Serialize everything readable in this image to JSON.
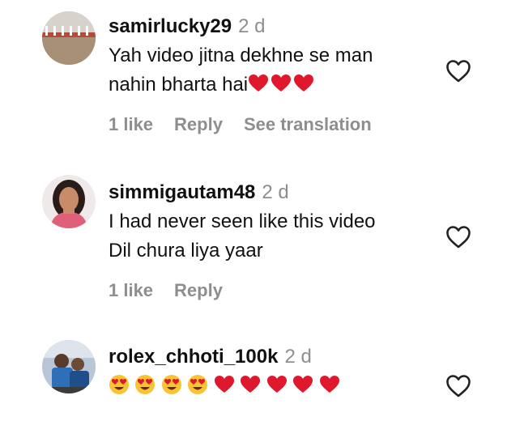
{
  "comments": [
    {
      "username": "samirlucky29",
      "time": "2 d",
      "text_line1": "Yah video jitna dekhne se man",
      "text_line2": "nahin bharta hai",
      "likes": "1 like",
      "reply": "Reply",
      "translation": "See translation"
    },
    {
      "username": "simmigautam48",
      "time": "2 d",
      "text_line1": "I had never seen like this video",
      "text_line2": "Dil chura liya yaar",
      "likes": "1 like",
      "reply": "Reply"
    },
    {
      "username": "rolex_chhoti_100k",
      "time": "2 d"
    }
  ],
  "icons": {
    "like": "heart-outline-icon",
    "red_heart": "red-heart-emoji",
    "heart_eyes": "heart-eyes-emoji"
  },
  "colors": {
    "username": "#111111",
    "meta": "#8e8e8e",
    "emoji_heart": "#e0182d"
  }
}
